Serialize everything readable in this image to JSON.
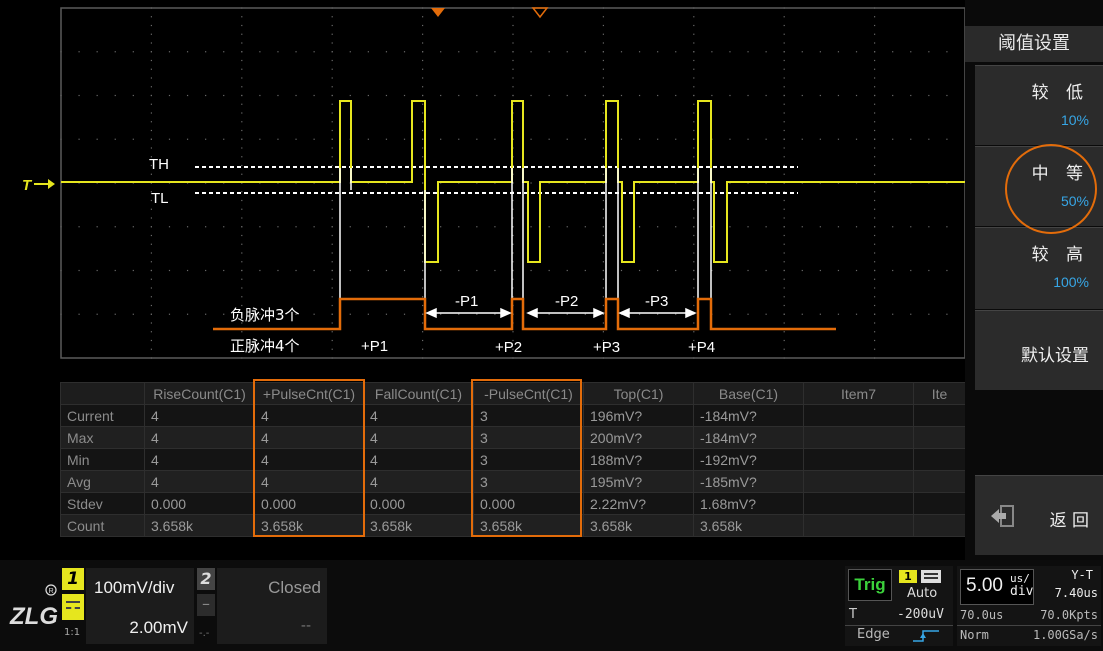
{
  "waveform": {
    "trigger_marker": "T",
    "th_label": "TH",
    "tl_label": "TL",
    "neg_pulse_note": "负脉冲3个",
    "pos_pulse_note": "正脉冲4个",
    "pos_pulse_labels": [
      "+P1",
      "+P2",
      "+P3",
      "+P4"
    ],
    "neg_pulse_labels": [
      "-P1",
      "-P2",
      "-P3"
    ],
    "colors": {
      "trace": "#e6e61e",
      "annotation": "#e36c0a",
      "grid": "#555555"
    }
  },
  "measurements": {
    "columns": [
      "",
      "RiseCount(C1)",
      "+PulseCnt(C1)",
      "FallCount(C1)",
      "-PulseCnt(C1)",
      "Top(C1)",
      "Base(C1)",
      "Item7",
      "Ite"
    ],
    "rows": [
      {
        "label": "Current",
        "values": [
          "4",
          "4",
          "4",
          "3",
          "196mV?",
          "-184mV?",
          "",
          ""
        ]
      },
      {
        "label": "Max",
        "values": [
          "4",
          "4",
          "4",
          "3",
          "200mV?",
          "-184mV?",
          "",
          ""
        ]
      },
      {
        "label": "Min",
        "values": [
          "4",
          "4",
          "4",
          "3",
          "188mV?",
          "-192mV?",
          "",
          ""
        ]
      },
      {
        "label": "Avg",
        "values": [
          "4",
          "4",
          "4",
          "3",
          "195mV?",
          "-185mV?",
          "",
          ""
        ]
      },
      {
        "label": "Stdev",
        "values": [
          "0.000",
          "0.000",
          "0.000",
          "0.000",
          "2.22mV?",
          "1.68mV?",
          "",
          ""
        ]
      },
      {
        "label": "Count",
        "values": [
          "3.658k",
          "3.658k",
          "3.658k",
          "3.658k",
          "3.658k",
          "3.658k",
          "",
          ""
        ]
      }
    ]
  },
  "menu": {
    "title": "阈值设置",
    "low_label": "较 低",
    "low_value": "10%",
    "mid_label": "中 等",
    "mid_value": "50%",
    "high_label": "较 高",
    "high_value": "100%",
    "default_label": "默认设置",
    "back_label": "返 回"
  },
  "channels": {
    "ch1_number": "1",
    "ch1_scale": "100mV/div",
    "ch1_offset": "2.00mV",
    "ch1_coupling": "1:1",
    "ch2_number": "2",
    "ch2_status": "Closed",
    "ch2_offset": "--",
    "ch2_coupling": "-.-",
    "ch1_color": "#e6e61e"
  },
  "trigger": {
    "state": "Trig",
    "source": "1",
    "mode": "Auto",
    "level_label": "T",
    "level_value": "-200uV",
    "type": "Edge"
  },
  "timebase": {
    "scale": "5.00",
    "unit_top": "us/",
    "unit_bottom": "div",
    "mode": "Y-T",
    "delay": "7.40us",
    "position": "70.0us",
    "points": "70.0Kpts",
    "acq": "Norm",
    "rate": "1.00GSa/s"
  }
}
